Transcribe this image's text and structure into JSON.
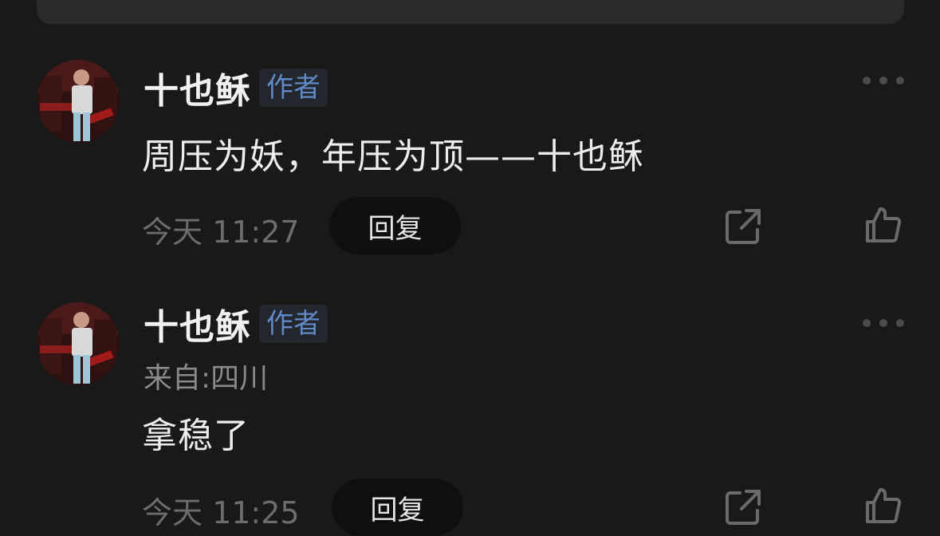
{
  "comments": [
    {
      "author": "十也稣",
      "badge": "作者",
      "content": "周压为妖，年压为顶——十也稣",
      "time": "今天 11:27",
      "reply_label": "回复"
    },
    {
      "author": "十也稣",
      "badge": "作者",
      "location": "来自:四川",
      "content": "拿稳了",
      "time": "今天 11:25",
      "reply_label": "回复"
    }
  ],
  "colors": {
    "background": "#191919",
    "badge_text": "#5f89c4",
    "badge_bg": "#23262c",
    "muted_text": "#6c6c6c",
    "reply_bg": "#0f0f0f"
  },
  "icons": [
    "more-icon",
    "share-icon",
    "like-icon"
  ]
}
